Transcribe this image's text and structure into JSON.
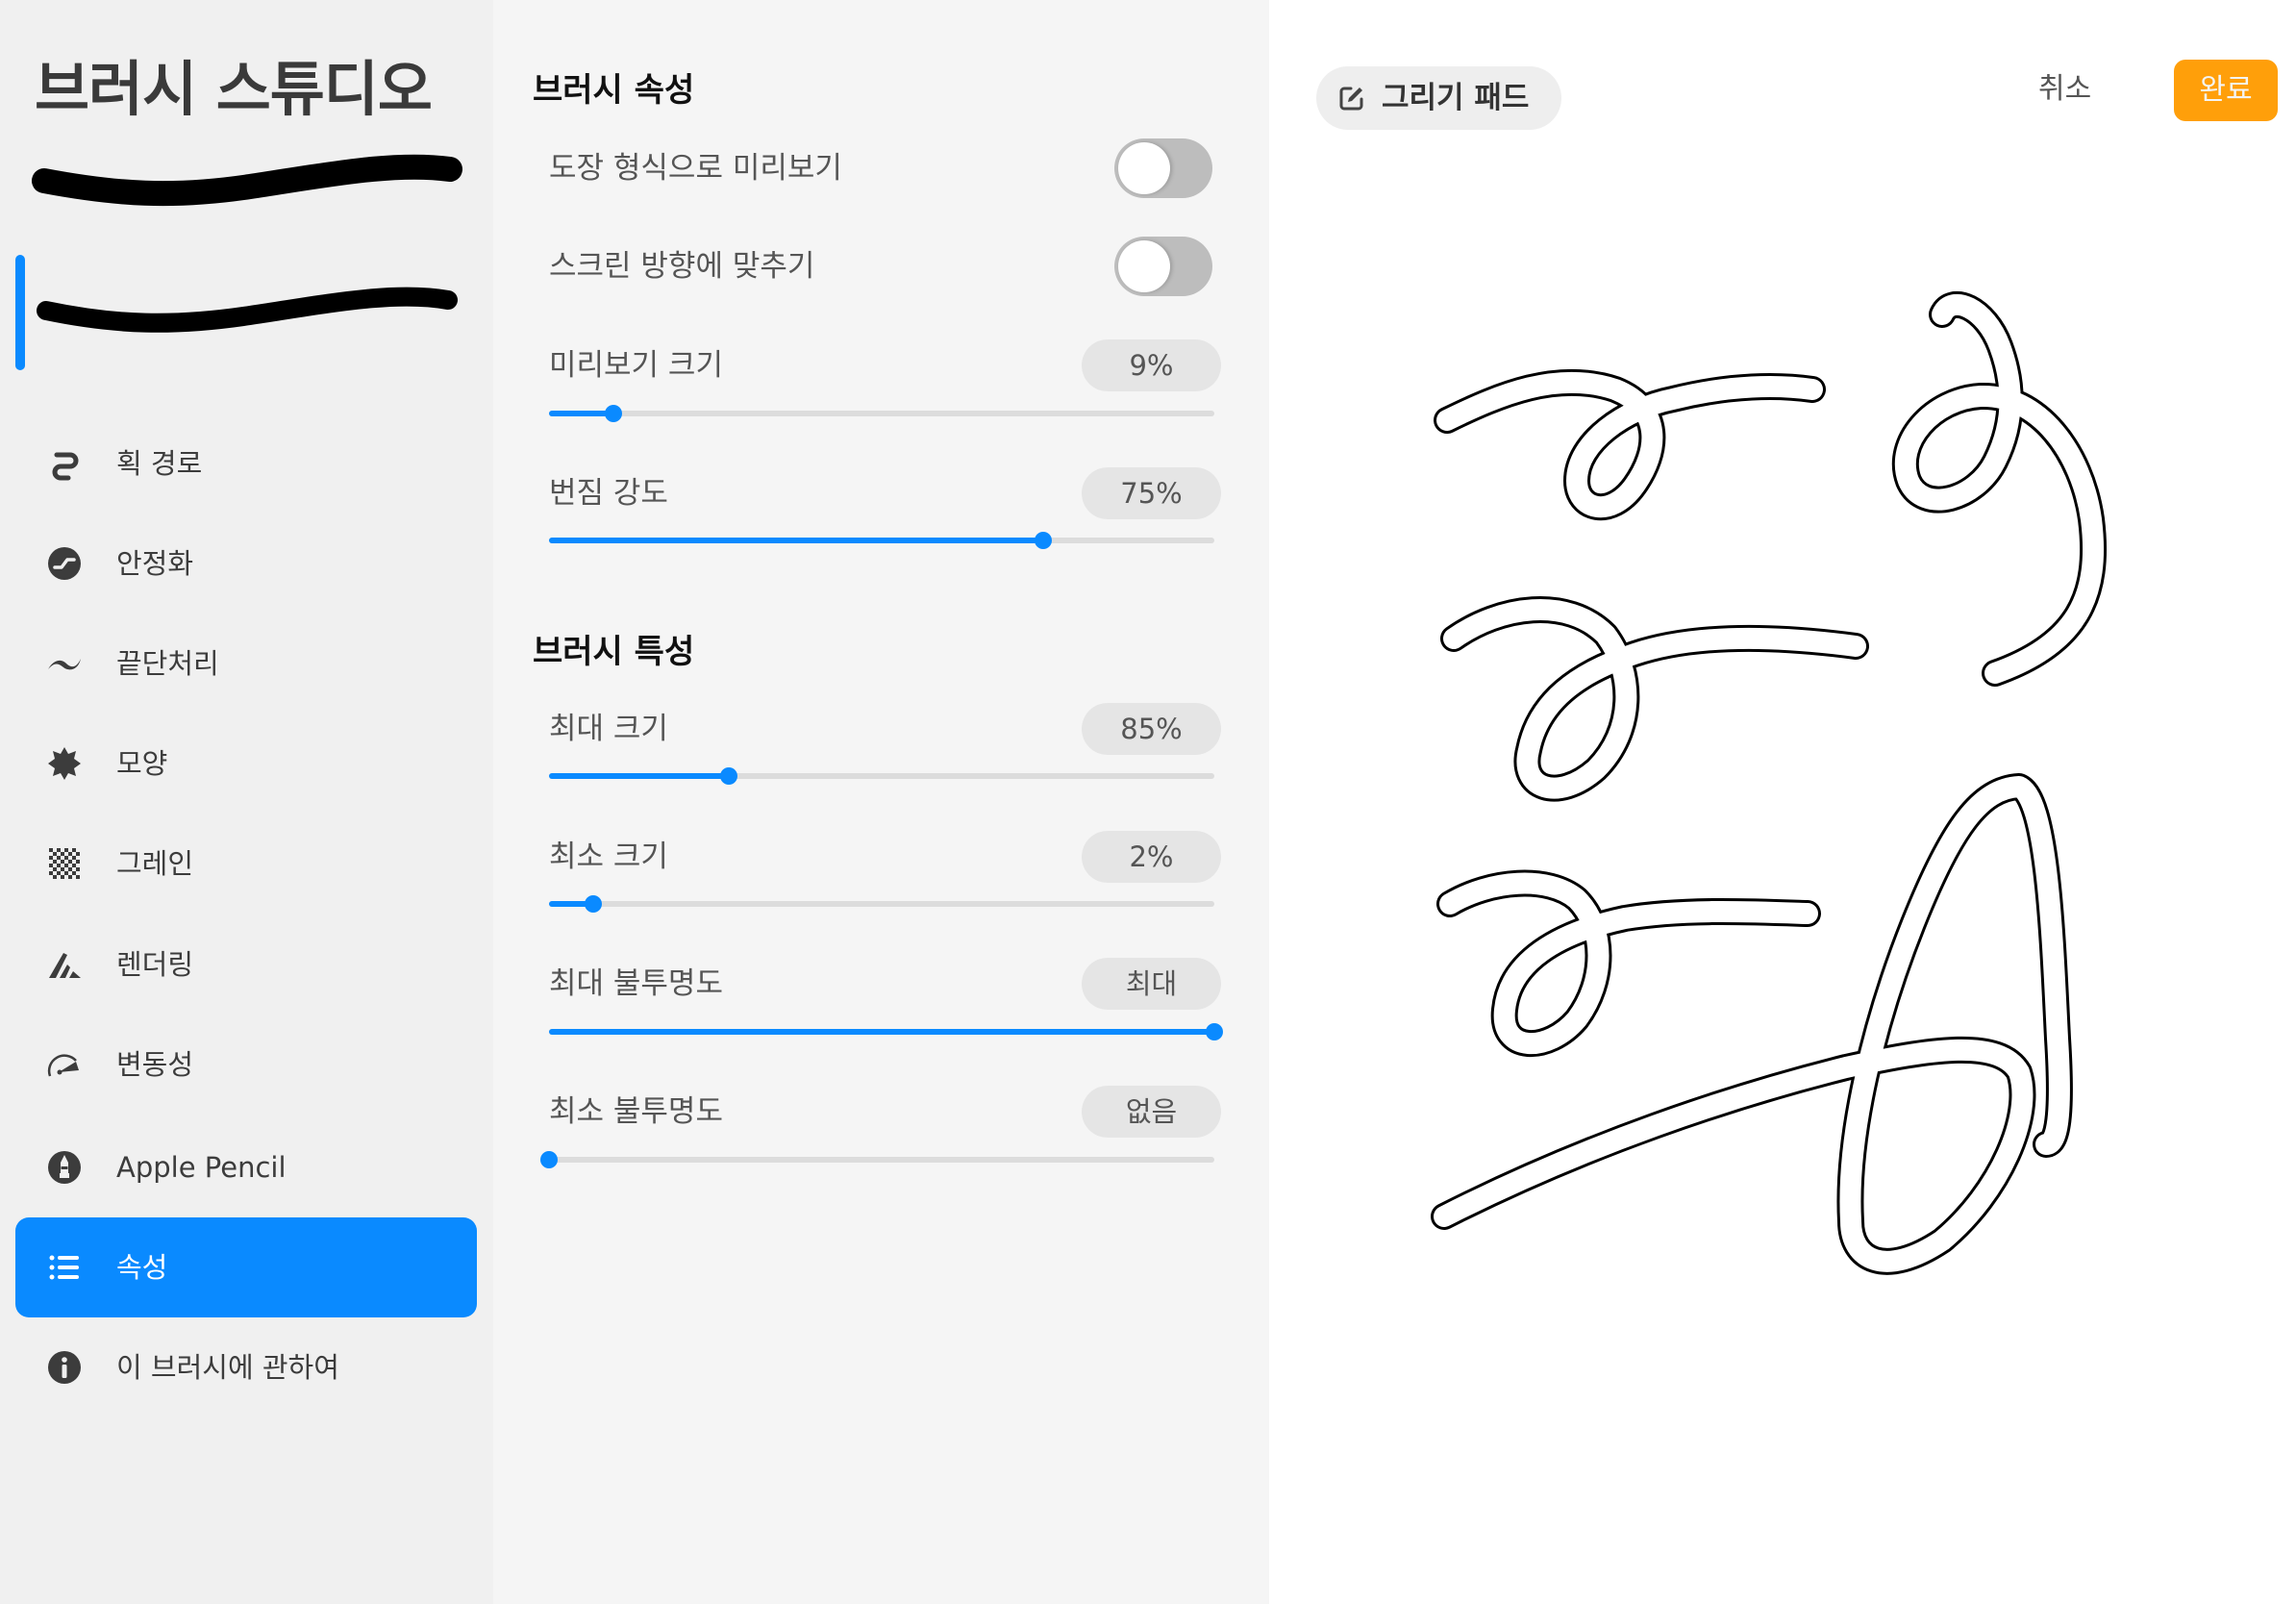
{
  "sidebar": {
    "title": "브러시 스튜디오",
    "previews": [
      {
        "name": "stroke-preview-default",
        "selected": false
      },
      {
        "name": "stroke-preview-current",
        "selected": true
      }
    ],
    "items": [
      {
        "label": "획 경로",
        "icon": "stroke-path-icon",
        "active": false
      },
      {
        "label": "안정화",
        "icon": "stabilization-icon",
        "active": false
      },
      {
        "label": "끝단처리",
        "icon": "taper-icon",
        "active": false
      },
      {
        "label": "모양",
        "icon": "shape-icon",
        "active": false
      },
      {
        "label": "그레인",
        "icon": "grain-icon",
        "active": false
      },
      {
        "label": "렌더링",
        "icon": "rendering-icon",
        "active": false
      },
      {
        "label": "변동성",
        "icon": "dynamics-icon",
        "active": false
      },
      {
        "label": "Apple Pencil",
        "icon": "apple-pencil-icon",
        "active": false
      },
      {
        "label": "속성",
        "icon": "list-icon",
        "active": true
      },
      {
        "label": "이 브러시에 관하여",
        "icon": "info-icon",
        "active": false
      }
    ]
  },
  "properties": {
    "section1": {
      "heading": "브러시 속성",
      "toggles": [
        {
          "label": "도장 형식으로 미리보기",
          "on": false
        },
        {
          "label": "스크린 방향에 맞추기",
          "on": false
        }
      ],
      "sliders": [
        {
          "label": "미리보기 크기",
          "value": "9%",
          "fraction": 0.097
        },
        {
          "label": "번짐 강도",
          "value": "75%",
          "fraction": 0.743
        }
      ]
    },
    "section2": {
      "heading": "브러시 특성",
      "sliders": [
        {
          "label": "최대 크기",
          "value": "85%",
          "fraction": 0.27
        },
        {
          "label": "최소 크기",
          "value": "2%",
          "fraction": 0.066
        },
        {
          "label": "최대 불투명도",
          "value": "최대",
          "fraction": 1.0
        },
        {
          "label": "최소 불투명도",
          "value": "없음",
          "fraction": 0.0
        }
      ]
    }
  },
  "drawing_pad": {
    "pad_button_label": "그리기 패드",
    "cancel_label": "취소",
    "done_label": "완료"
  },
  "colors": {
    "accent": "#0a8aff",
    "done_button": "#ff9f0a",
    "sidebar_bg": "#f0f0f0",
    "panel_bg": "#f5f5f5",
    "canvas_bg": "#ffffff"
  }
}
